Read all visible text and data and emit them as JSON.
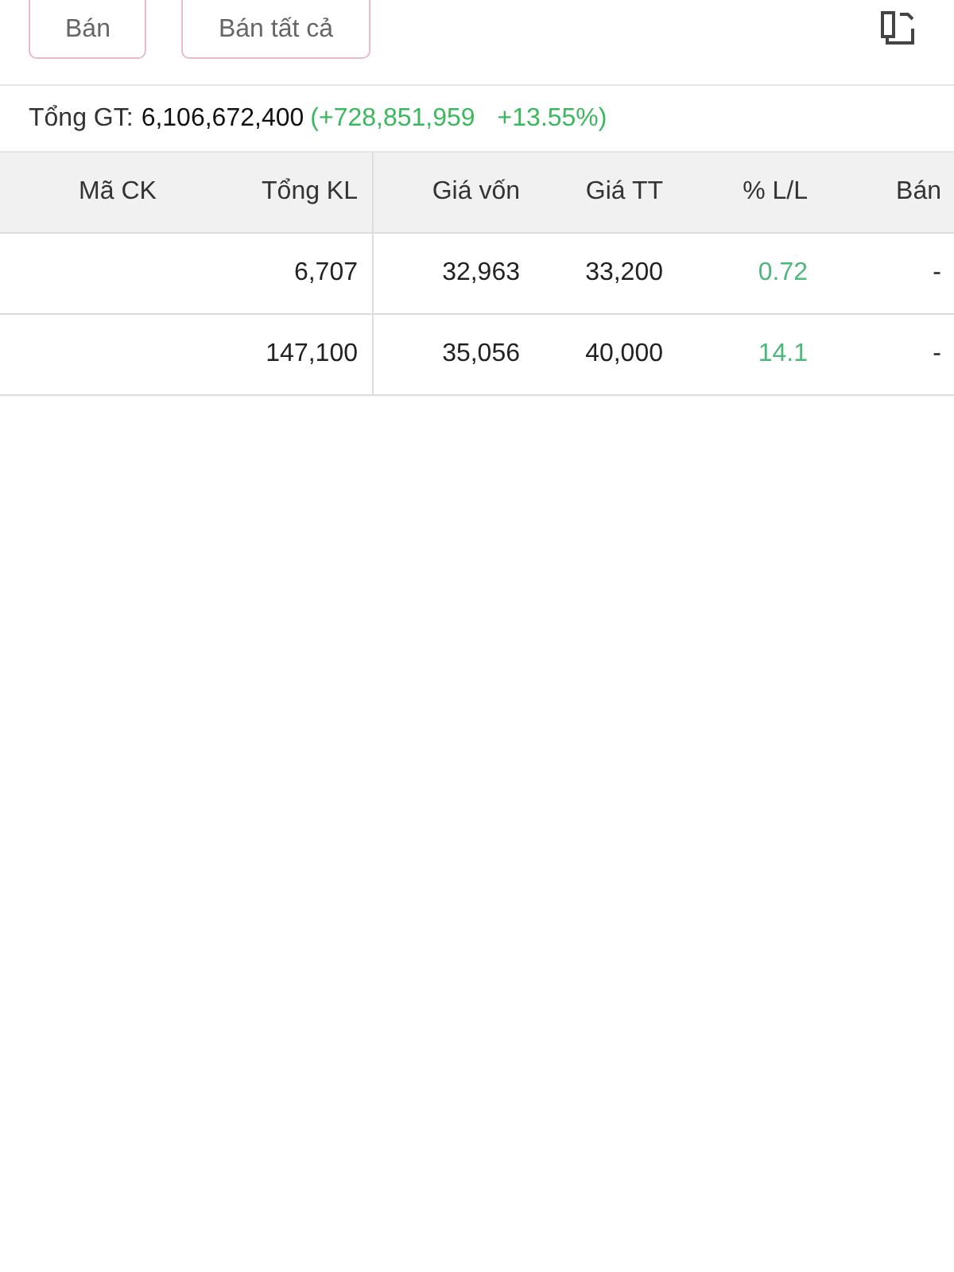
{
  "actions": [
    {
      "label": "Bán"
    },
    {
      "label": "Bán tất cả"
    }
  ],
  "summary": {
    "label": "Tổng GT:",
    "value": "6,106,672,400",
    "change": "(+728,851,959",
    "percent": "+13.55%)",
    "color": "#3cb85c"
  },
  "table": {
    "columns": [
      "Mã CK",
      "Tổng KL",
      "Giá vốn",
      "Giá TT",
      "% L/L",
      "Bán"
    ],
    "rows": [
      {
        "cells": [
          "",
          "6,707",
          "32,963",
          "33,200",
          "0.72",
          "-"
        ],
        "color": "#4cb87a"
      },
      {
        "cells": [
          "",
          "147,100",
          "35,056",
          "40,000",
          "14.1",
          "-"
        ],
        "color": "#4cb87a"
      }
    ]
  }
}
